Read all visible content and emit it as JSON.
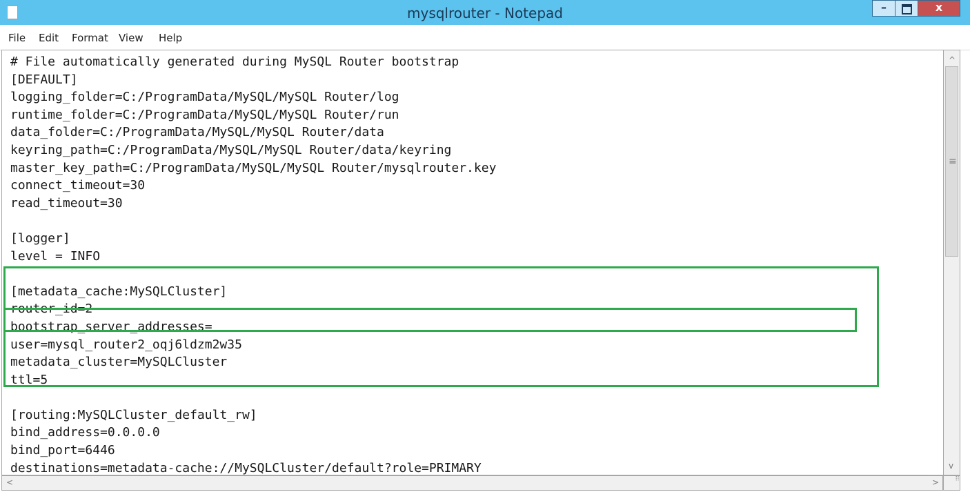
{
  "window": {
    "title": "mysqlrouter - Notepad",
    "controls": {
      "minimize": "–",
      "close": "x"
    }
  },
  "menu": [
    "File",
    "Edit",
    "Format",
    "View",
    "Help"
  ],
  "editor": {
    "lines": [
      "# File automatically generated during MySQL Router bootstrap",
      "[DEFAULT]",
      "logging_folder=C:/ProgramData/MySQL/MySQL Router/log",
      "runtime_folder=C:/ProgramData/MySQL/MySQL Router/run",
      "data_folder=C:/ProgramData/MySQL/MySQL Router/data",
      "keyring_path=C:/ProgramData/MySQL/MySQL Router/data/keyring",
      "master_key_path=C:/ProgramData/MySQL/MySQL Router/mysqlrouter.key",
      "connect_timeout=30",
      "read_timeout=30",
      "",
      "[logger]",
      "level = INFO",
      "",
      "[metadata_cache:MySQLCluster]",
      "router_id=2",
      "bootstrap_server_addresses=",
      "user=mysql_router2_oqj6ldzm2w35",
      "metadata_cluster=MySQLCluster",
      "ttl=5",
      "",
      "[routing:MySQLCluster_default_rw]",
      "bind_address=0.0.0.0",
      "bind_port=6446",
      "destinations=metadata-cache://MySQLCluster/default?role=PRIMARY"
    ]
  },
  "scrollbars": {
    "up": "^",
    "down": "v",
    "left": "<",
    "right": ">",
    "thumb": "≡"
  },
  "colors": {
    "titlebar": "#5cc3ee",
    "highlight": "#2eaa4d",
    "close_button": "#c75050"
  }
}
